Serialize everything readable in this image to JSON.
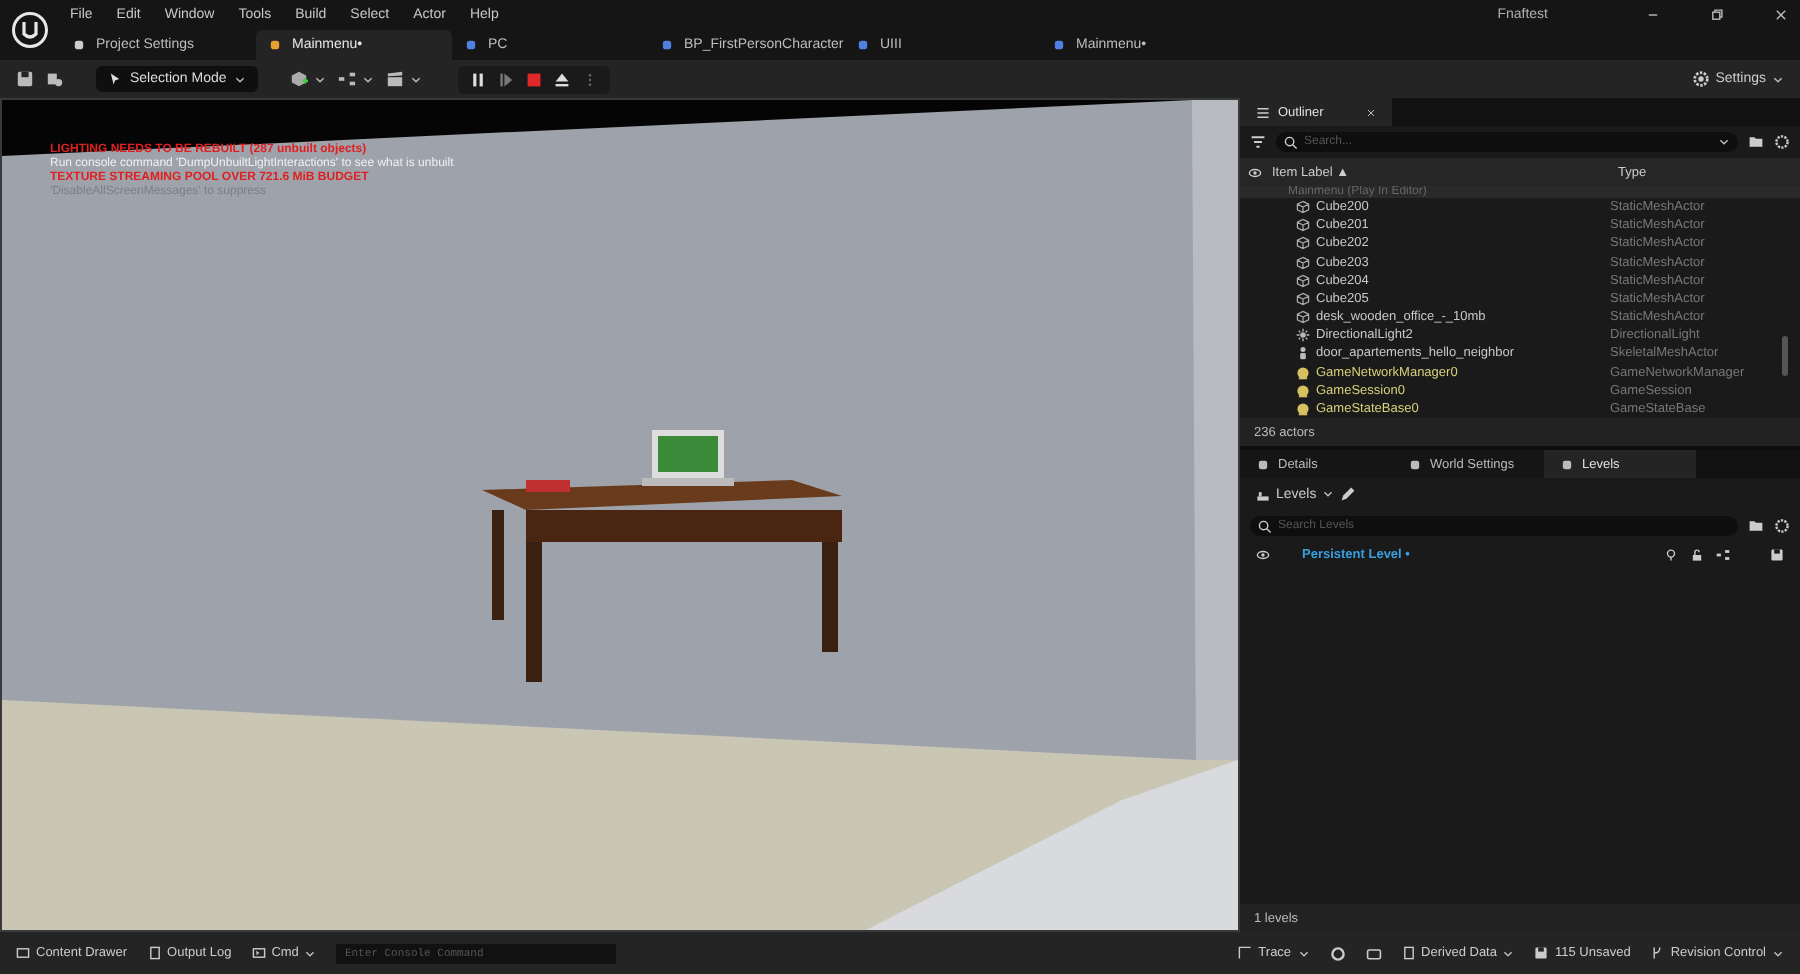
{
  "menu": [
    "File",
    "Edit",
    "Window",
    "Tools",
    "Build",
    "Select",
    "Actor",
    "Help"
  ],
  "project_name": "Fnaftest",
  "tabs": [
    {
      "label": "Project Settings",
      "selected": false
    },
    {
      "label": "Mainmenu•",
      "selected": true
    },
    {
      "label": "PC",
      "selected": false
    },
    {
      "label": "BP_FirstPersonCharacter",
      "selected": false
    },
    {
      "label": "UIII",
      "selected": false
    },
    {
      "label": "Mainmenu•",
      "selected": false
    }
  ],
  "toolbar": {
    "mode": "Selection Mode",
    "settings": "Settings"
  },
  "viewport": {
    "messages": [
      {
        "text": "LIGHTING NEEDS TO BE REBUILT (287 unbuilt objects)",
        "kind": "error"
      },
      {
        "text": "Run console command 'DumpUnbuiltLightInteractions' to see what is unbuilt",
        "kind": "info"
      },
      {
        "text": "TEXTURE STREAMING POOL OVER 721.6 MiB BUDGET",
        "kind": "error"
      },
      {
        "text": "'DisableAllScreenMessages' to suppress",
        "kind": "muted"
      }
    ]
  },
  "outliner": {
    "title": "Outliner",
    "search_placeholder": "Search...",
    "columns": [
      "Item Label ▲",
      "Type"
    ],
    "group": "Mainmenu (Play In Editor)",
    "rows": [
      {
        "label": "Cube200",
        "type": "StaticMeshActor",
        "kind": "mesh"
      },
      {
        "label": "Cube201",
        "type": "StaticMeshActor",
        "kind": "mesh"
      },
      {
        "label": "Cube202",
        "type": "StaticMeshActor",
        "kind": "mesh"
      },
      {
        "label": "Cube203",
        "type": "StaticMeshActor",
        "kind": "mesh"
      },
      {
        "label": "Cube204",
        "type": "StaticMeshActor",
        "kind": "mesh"
      },
      {
        "label": "Cube205",
        "type": "StaticMeshActor",
        "kind": "mesh"
      },
      {
        "label": "desk_wooden_office_-_10mb",
        "type": "StaticMeshActor",
        "kind": "mesh"
      },
      {
        "label": "DirectionalLight2",
        "type": "DirectionalLight",
        "kind": "light"
      },
      {
        "label": "door_apartements_hello_neighbor",
        "type": "SkeletalMeshActor",
        "kind": "skeletal"
      },
      {
        "label": "GameNetworkManager0",
        "type": "GameNetworkManager",
        "kind": "game"
      },
      {
        "label": "GameSession0",
        "type": "GameSession",
        "kind": "game"
      },
      {
        "label": "GameStateBase0",
        "type": "GameStateBase",
        "kind": "game"
      }
    ],
    "footer": "236 actors"
  },
  "panel": {
    "tabs": [
      {
        "label": "Details",
        "selected": false
      },
      {
        "label": "World Settings",
        "selected": false
      },
      {
        "label": "Levels",
        "selected": true
      }
    ],
    "levels_button": "Levels",
    "search_placeholder": "Search Levels",
    "levels": [
      {
        "label": "Persistent Level •"
      }
    ],
    "footer": "1 levels"
  },
  "status_bar": {
    "content_drawer": "Content Drawer",
    "output_log": "Output Log",
    "cmd": "Cmd",
    "console_placeholder": "Enter Console Command",
    "trace": "Trace",
    "derived_data": "Derived Data",
    "unsaved": "115 Unsaved",
    "revision_control": "Revision Control"
  }
}
